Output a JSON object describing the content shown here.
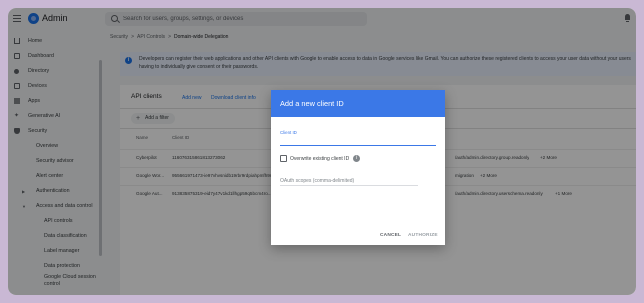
{
  "app": {
    "title": "Admin"
  },
  "search": {
    "placeholder": "Search for users, groups, settings, or devices"
  },
  "sidebar": {
    "items": [
      {
        "label": "Home"
      },
      {
        "label": "Dashboard"
      },
      {
        "label": "Directory"
      },
      {
        "label": "Devices"
      },
      {
        "label": "Apps"
      },
      {
        "label": "Generative AI"
      },
      {
        "label": "Security"
      },
      {
        "label": "Overview"
      },
      {
        "label": "Security advisor"
      },
      {
        "label": "Alert center"
      },
      {
        "label": "Authentication"
      },
      {
        "label": "Access and data control"
      },
      {
        "label": "API controls"
      },
      {
        "label": "Data classification"
      },
      {
        "label": "Label manager"
      },
      {
        "label": "Data protection"
      },
      {
        "label": "Google Cloud session control"
      }
    ]
  },
  "breadcrumb": {
    "items": [
      "Security",
      "API Controls",
      "Domain-wide Delegation"
    ],
    "separator": ">"
  },
  "info": {
    "text": "Developers can register their web applications and other API clients with Google to enable access to data in Google services like Gmail. You can authorize these registered clients to access your user data without your users having to individually give consent or their passwords."
  },
  "panel": {
    "title": "API clients",
    "add_new": "Add new",
    "download": "Download client info",
    "filter": "Add a filter",
    "columns": {
      "name": "Name",
      "client_id": "Client ID"
    },
    "rows": [
      {
        "name": "Cyberpilot",
        "client_id": "116076315861813273062",
        "scope": "/auth/admin.directory.group.readonly",
        "more": "+2 More"
      },
      {
        "name": "Google Wor...",
        "client_id": "955661971473-ie97vhvsnidb19rbr9rdpiahpmfh9rk...",
        "scope": "migration",
        "more": "+2 More"
      },
      {
        "name": "Google Aut...",
        "client_id": "913835875319-eid7y47v1kd1llhgp59q5bcm4ro...",
        "scope": "/auth/admin.directory.userschema.readonly",
        "more": "+1 More"
      }
    ]
  },
  "dialog": {
    "title": "Add a new client ID",
    "client_id_label": "Client ID",
    "client_id_value": "",
    "overwrite_label": "Overwrite existing client ID",
    "scopes_placeholder": "OAuth scopes (comma-delimited)",
    "cancel": "CANCEL",
    "authorize": "AUTHORIZE"
  },
  "colors": {
    "accent": "#3b78e7",
    "link": "#1a73e8",
    "info_bg": "#e8f0fe",
    "outer_bg": "#c9b8d4"
  }
}
